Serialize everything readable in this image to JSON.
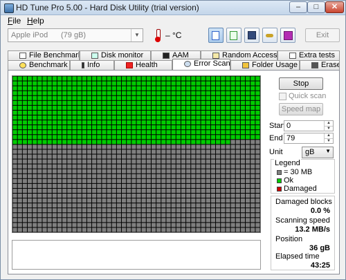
{
  "window": {
    "title": "HD Tune Pro 5.00 - Hard Disk Utility (trial version)",
    "min": "–",
    "max": "□",
    "close": "✕"
  },
  "menu": [
    {
      "label": "File",
      "accel": "F",
      "rest": "ile"
    },
    {
      "label": "Help",
      "accel": "H",
      "rest": "elp"
    }
  ],
  "toolbar": {
    "drive_name": "Apple  iPod",
    "drive_size": "(79 gB)",
    "temperature": "– °C",
    "buttons": [
      "copy-info-icon",
      "copy-screenshot-icon",
      "save-icon",
      "options-key-icon",
      "exit-arrow-icon"
    ],
    "exit_label": "Exit"
  },
  "tabs_row1": [
    {
      "label": "File Benchmark",
      "icon": "file-benchmark-icon"
    },
    {
      "label": "Disk monitor",
      "icon": "disk-monitor-icon"
    },
    {
      "label": "AAM",
      "icon": "speaker-icon"
    },
    {
      "label": "Random Access",
      "icon": "random-access-icon"
    },
    {
      "label": "Extra tests",
      "icon": "extra-tests-icon"
    }
  ],
  "tabs_row2": [
    {
      "label": "Benchmark",
      "icon": "bulb-icon"
    },
    {
      "label": "Info",
      "icon": "info-icon"
    },
    {
      "label": "Health",
      "icon": "health-cross-icon"
    },
    {
      "label": "Error Scan",
      "icon": "magnifier-icon",
      "selected": true
    },
    {
      "label": "Folder Usage",
      "icon": "folder-icon"
    },
    {
      "label": "Erase",
      "icon": "trash-icon"
    }
  ],
  "error_scan": {
    "stop_label": "Stop",
    "quick_scan_label": "Quick scan",
    "quick_scan_checked": false,
    "speed_map_label": "Speed map",
    "start_label": "Start",
    "start_value": "0",
    "end_label": "End",
    "end_value": "79",
    "unit_label": "Unit",
    "unit_value": "gB",
    "legend_title": "Legend",
    "legend": [
      {
        "label": "= 30 MB",
        "color": "#808080"
      },
      {
        "label": "Ok",
        "color": "#00cc00"
      },
      {
        "label": "Damaged",
        "color": "#d00000"
      }
    ],
    "damaged_blocks_label": "Damaged blocks",
    "damaged_blocks_value": "0.0 %",
    "scanning_speed_label": "Scanning speed",
    "scanning_speed_value": "13.2 MB/s",
    "position_label": "Position",
    "position_value": "36 gB",
    "elapsed_label": "Elapsed time",
    "elapsed_value": "43:25",
    "grid": {
      "columns": 50,
      "rows": 32,
      "ok_full_rows": 13,
      "ok_partial_columns": 44
    }
  },
  "colors": {
    "ok": "#00cc00",
    "unscanned": "#7f7f7f",
    "damaged": "#d00000"
  }
}
